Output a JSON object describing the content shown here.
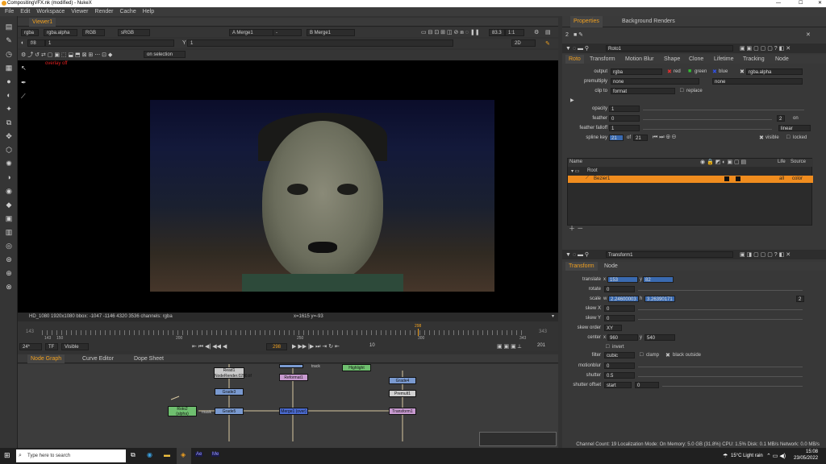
{
  "window": {
    "title": "CompositingVFX.nk (modified) - NukeX"
  },
  "menu": [
    "File",
    "Edit",
    "Workspace",
    "Viewer",
    "Render",
    "Cache",
    "Help"
  ],
  "viewer": {
    "tab": "Viewer1",
    "channels": "rgba",
    "alpha": "rgba.alpha",
    "colorspace": "RGB",
    "lut": "sRGB",
    "a_input": "A  Merge1",
    "dash": "-",
    "b_input": "B  Merge1",
    "fstop": "f/8",
    "frame_step": "1",
    "y_label": "Y",
    "y_value": "1",
    "zoom": "83.3",
    "ratio": "1:1",
    "view_mode": "2D",
    "proxy_mode": "on selection",
    "overlay": "overlay off",
    "info": "HD_1080 1920x1080  bbox: -1047 -1146 4320 3536 channels: rgba",
    "coords": "x=1615 y=-93"
  },
  "timeline": {
    "start": "143",
    "end": "343",
    "ticks": [
      "143",
      "150",
      "200",
      "250",
      "300",
      "343"
    ],
    "current": "298",
    "playhead_marker": "298",
    "fps": "24*",
    "tf": "TF",
    "visible": "Visible",
    "step": "10",
    "end_frame": "201"
  },
  "bottom_tabs": [
    "Node Graph",
    "Curve Editor",
    "Dope Sheet"
  ],
  "nodes": [
    {
      "name": "Read1",
      "sub": "NodeRender.0290.tif",
      "color": "#c8c8c8"
    },
    {
      "name": "Grade3",
      "sub": "",
      "color": "#7a9ad0"
    },
    {
      "name": "Grade5",
      "sub": "",
      "color": "#7a9ad0"
    },
    {
      "name": "Roto2",
      "sub": "(alpha)",
      "color": "#6fbf6f"
    },
    {
      "name": "Reformat1",
      "sub": "",
      "color": "#c89ad0"
    },
    {
      "name": "Merge1 (over)",
      "sub": "",
      "color": "#4a6ad0"
    },
    {
      "name": "Highlight",
      "sub": "",
      "color": "#6fbf6f"
    },
    {
      "name": "Grade4",
      "sub": "",
      "color": "#7a9ad0"
    },
    {
      "name": "Premult1",
      "sub": "",
      "color": "#d0d0d0"
    },
    {
      "name": "Transform1",
      "sub": "",
      "color": "#c89ad0"
    }
  ],
  "node_labels": {
    "mask": "mask",
    "track": "track"
  },
  "properties": {
    "tabs": [
      "Properties",
      "Background Renders"
    ],
    "count": "2",
    "roto": {
      "name": "Roto1",
      "tabs": [
        "Roto",
        "Transform",
        "Motion Blur",
        "Shape",
        "Clone",
        "Lifetime",
        "Tracking",
        "Node"
      ],
      "output": "rgba",
      "red": "red",
      "green": "green",
      "blue": "blue",
      "alpha": "rgba.alpha",
      "premultiply": "none",
      "premultiply2": "none",
      "clip_to": "format",
      "replace": "replace",
      "opacity": "1",
      "feather": "0",
      "feather_falloff": "1",
      "falloff_type": "linear",
      "spline_key": "21",
      "spline_of": "of",
      "spline_total": "21",
      "visible": "visible",
      "locked": "locked",
      "feather_on_count": "2",
      "on": "on",
      "labels": {
        "output": "output",
        "premultiply": "premultiply",
        "clip_to": "clip to",
        "opacity": "opacity",
        "feather": "feather",
        "feather_falloff": "feather falloff",
        "spline_key": "spline key"
      },
      "list_headers": [
        "Name",
        "Life",
        "Source"
      ],
      "list_root": "Root",
      "list_item": "Bezier1",
      "list_item_life": "all",
      "list_item_source": "color"
    },
    "transform": {
      "name": "Transform1",
      "tabs": [
        "Transform",
        "Node"
      ],
      "translate_x": "153",
      "translate_y": "82",
      "rotate": "0",
      "scale_w": "2.24600003",
      "scale_h": "3.26390171",
      "scale_count": "2",
      "skew_x": "0",
      "skew_y": "0",
      "skew_order": "XY",
      "center_x": "960",
      "center_y": "540",
      "invert": "invert",
      "filter": "cubic",
      "clamp": "clamp",
      "black_outside": "black outside",
      "motionblur": "0",
      "shutter": "0.5",
      "shutter_offset": "start",
      "shutter_offset_val": "0",
      "labels": {
        "translate": "translate",
        "rotate": "rotate",
        "scale": "scale",
        "skew_x": "skew X",
        "skew_y": "skew Y",
        "skew_order": "skew order",
        "center": "center",
        "filter": "filter",
        "motionblur": "motionblur",
        "shutter": "shutter",
        "shutter_offset": "shutter offset",
        "x": "x",
        "y": "y",
        "w": "w",
        "h": "h"
      }
    }
  },
  "status": "Channel Count: 19  Localization Mode: On  Memory: 5.0 GB (31.8%)  CPU: 1.5%  Disk: 0.1 MB/s  Network: 0.0 MB/s",
  "taskbar": {
    "search": "Type here to search",
    "weather": "15°C  Light rain",
    "time": "15:08",
    "date": "23/05/2022",
    "apps": [
      "Ae",
      "Me"
    ]
  },
  "colors": {
    "accent": "#f0a020",
    "selected_row": "#f08c1e",
    "roto_node": "#6fbf6f",
    "merge_node": "#4a6ad0"
  }
}
